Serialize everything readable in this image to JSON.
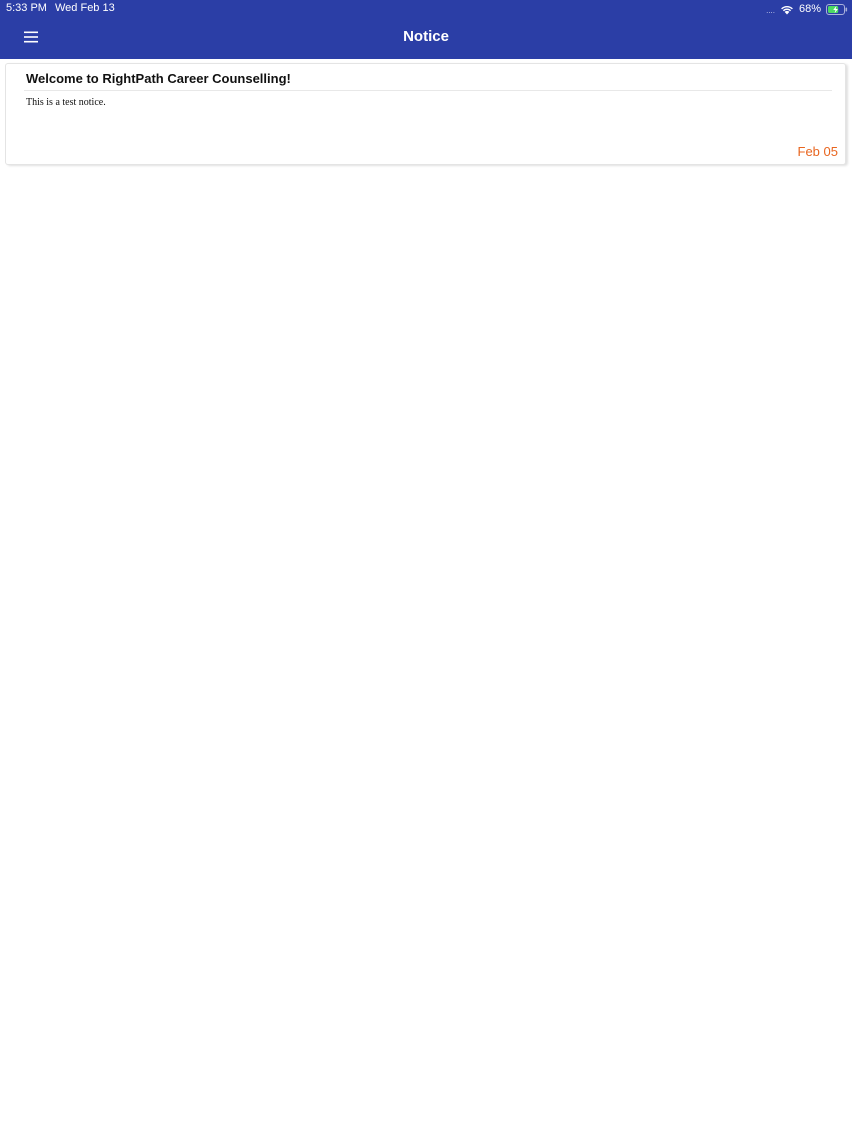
{
  "status_bar": {
    "time": "5:33 PM",
    "date": "Wed Feb 13",
    "signal": "....",
    "battery_percent": "68%",
    "battery_level": 0.68,
    "charging": true
  },
  "nav": {
    "title": "Notice",
    "menu_icon": "hamburger-menu-icon"
  },
  "notices": [
    {
      "title": "Welcome to RightPath Career Counselling!",
      "body": "This is a test notice.",
      "date": "Feb 05"
    }
  ],
  "colors": {
    "header_bg": "#2b3ea6",
    "accent_date": "#e8651f",
    "battery_fill": "#4cd964"
  }
}
